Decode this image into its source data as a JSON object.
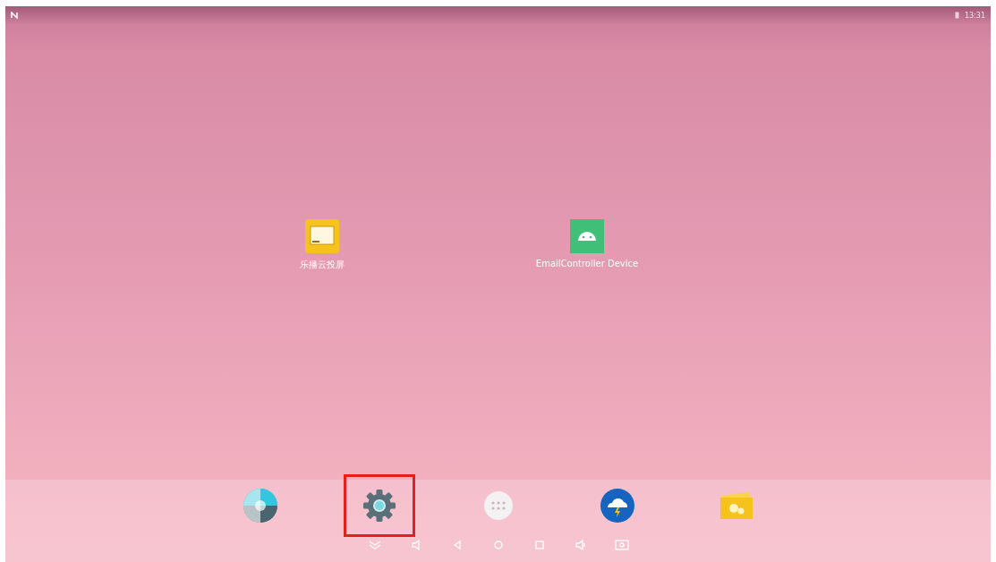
{
  "status_bar": {
    "time": "13:31"
  },
  "desktop_icons": [
    {
      "kind": "monitor",
      "label": "乐播云投屏"
    },
    {
      "kind": "android",
      "label": "EmailController Device"
    }
  ],
  "dock": [
    {
      "kind": "aperture",
      "highlighted": false
    },
    {
      "kind": "settings",
      "highlighted": true
    },
    {
      "kind": "apps",
      "highlighted": false
    },
    {
      "kind": "weather",
      "highlighted": false
    },
    {
      "kind": "folder",
      "highlighted": false
    }
  ],
  "nav_buttons": [
    {
      "kind": "hide"
    },
    {
      "kind": "volume-down"
    },
    {
      "kind": "back"
    },
    {
      "kind": "home"
    },
    {
      "kind": "recent"
    },
    {
      "kind": "volume-up"
    },
    {
      "kind": "screenshot"
    }
  ]
}
